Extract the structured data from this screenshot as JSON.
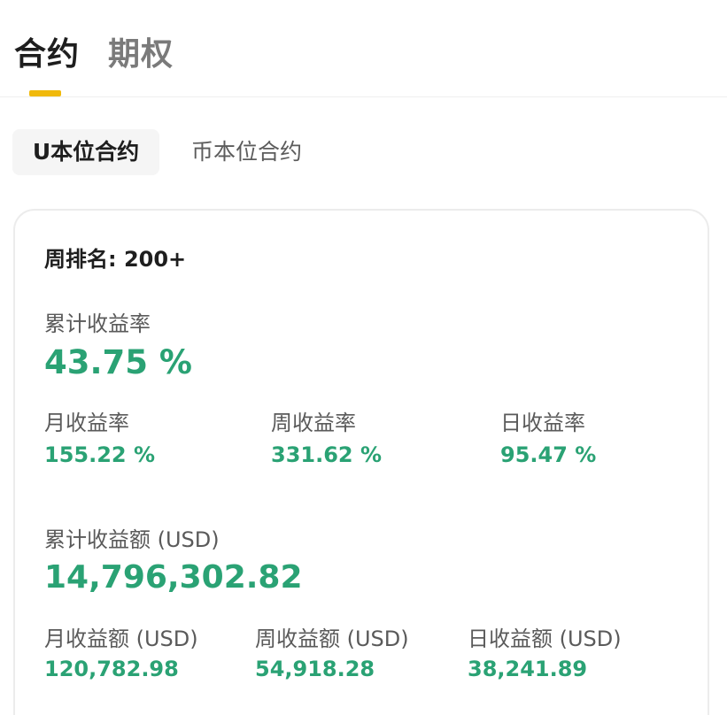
{
  "tabs": {
    "contract": "合约",
    "options": "期权"
  },
  "subtabs": {
    "u_contract": "U本位合约",
    "coin_contract": "币本位合约"
  },
  "card": {
    "rank": "周排名: 200+",
    "cumulative_rate_label": "累计收益率",
    "cumulative_rate_value": "43.75 %",
    "rates": [
      {
        "label": "月收益率",
        "value": "155.22 %"
      },
      {
        "label": "周收益率",
        "value": "331.62 %"
      },
      {
        "label": "日收益率",
        "value": "95.47 %"
      }
    ],
    "cumulative_amount_label": "累计收益额 (USD)",
    "cumulative_amount_value": "14,796,302.82",
    "amounts": [
      {
        "label": "月收益额 (USD)",
        "value": "120,782.98"
      },
      {
        "label": "周收益额 (USD)",
        "value": "54,918.28"
      },
      {
        "label": "日收益额 (USD)",
        "value": "38,241.89"
      }
    ]
  },
  "colors": {
    "accent": "#f0b90b",
    "profit": "#2aa274"
  }
}
